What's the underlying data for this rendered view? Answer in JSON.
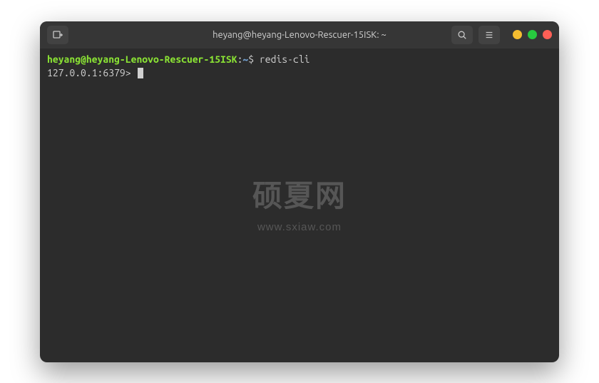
{
  "titlebar": {
    "title": "heyang@heyang-Lenovo-Rescuer-15ISK: ~"
  },
  "terminal": {
    "prompt_user": "heyang@heyang-Lenovo-Rescuer-15ISK",
    "prompt_colon": ":",
    "prompt_path": "~",
    "prompt_dollar": "$ ",
    "command": "redis-cli",
    "redis_prompt": "127.0.0.1:6379> "
  },
  "watermark": {
    "main": "硕夏网",
    "url": "www.sxiaw.com"
  }
}
